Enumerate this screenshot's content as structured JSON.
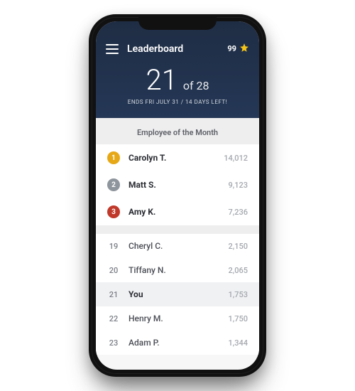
{
  "header": {
    "title": "Leaderboard",
    "points": "99"
  },
  "rank": {
    "current": "21",
    "of_label": "of",
    "total": "28",
    "subtitle": "ENDS FRI JULY 31 / 14 DAYS LEFT!"
  },
  "section": {
    "title": "Employee of the Month"
  },
  "top": [
    {
      "rank": "1",
      "name": "Carolyn T.",
      "score": "14,012"
    },
    {
      "rank": "2",
      "name": "Matt S.",
      "score": "9,123"
    },
    {
      "rank": "3",
      "name": "Amy K.",
      "score": "7,236"
    }
  ],
  "nearby": [
    {
      "rank": "19",
      "name": "Cheryl C.",
      "score": "2,150",
      "you": false
    },
    {
      "rank": "20",
      "name": "Tiffany N.",
      "score": "2,065",
      "you": false
    },
    {
      "rank": "21",
      "name": "You",
      "score": "1,753",
      "you": true
    },
    {
      "rank": "22",
      "name": "Henry M.",
      "score": "1,750",
      "you": false
    },
    {
      "rank": "23",
      "name": "Adam P.",
      "score": "1,344",
      "you": false
    }
  ]
}
